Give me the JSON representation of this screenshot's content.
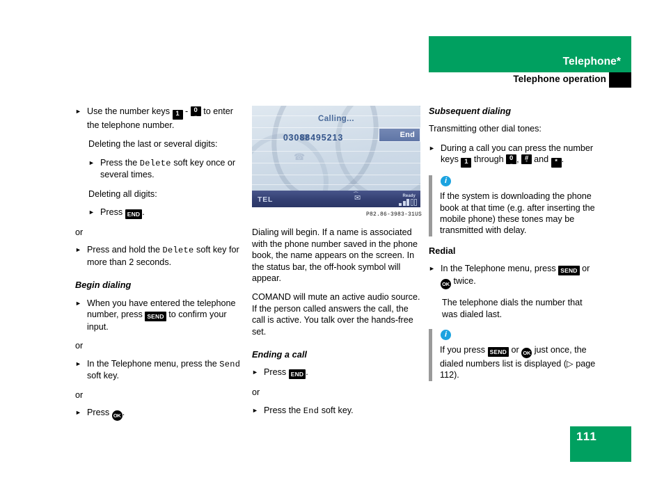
{
  "header": {
    "title": "Telephone*",
    "subtitle": "Telephone operation"
  },
  "footer": {
    "page_number": "111"
  },
  "colors": {
    "brand_green": "#00a060",
    "info_blue": "#1ba3e0",
    "note_bar_grey": "#9a9a9a",
    "screen_status_bar": "#333f72"
  },
  "left_column": {
    "b1_pre": "Use the number keys",
    "b1_key1": "1",
    "b1_dash": "-",
    "b1_key0": "0",
    "b1_post": "to enter the telephone number.",
    "p_delete_last": "Deleting the last or several digits:",
    "b2_pre": "Press the",
    "b2_softkey": "Delete",
    "b2_post": "soft key once or several times.",
    "p_delete_all": "Deleting all digits:",
    "b3_pre": "Press",
    "b3_key": "END",
    "b3_post": ".",
    "or1": "or",
    "b4_pre": "Press and hold the",
    "b4_softkey": "Delete",
    "b4_post": "soft key for more than 2 seconds.",
    "heading_begin_dialing": "Begin dialing",
    "b5_pre": "When you have entered the telephone number, press",
    "b5_key": "SEND",
    "b5_post": "to confirm your input.",
    "or2": "or",
    "b6_pre": "In the Telephone menu, press the",
    "b6_softkey": "Send",
    "b6_post": "soft key.",
    "or3": "or",
    "b7_pre": "Press",
    "b7_key": "OK",
    "b7_post": "."
  },
  "center_column": {
    "screen": {
      "calling_text": "Calling...",
      "phone_number": "03088495213",
      "softkey_end": "End",
      "status_source": "TEL",
      "status_ready": "Ready",
      "signal_bars_filled": 3,
      "signal_bars_empty": 2
    },
    "image_caption": "P82.86-3983-31US",
    "p1": "Dialing will begin. If a name is associated with the phone number saved in the phone book, the name appears on the screen. In the status bar, the off-hook symbol will appear.",
    "p2": "COMAND will mute an active audio source. If the person called answers the call, the call is active. You talk over the hands-free set.",
    "heading_ending_a_call": "Ending a call",
    "b1_pre": "Press",
    "b1_key": "END",
    "b1_post": ".",
    "or1": "or",
    "b2_pre": "Press the",
    "b2_softkey": "End",
    "b2_post": "soft key."
  },
  "right_column": {
    "heading_subsequent": "Subsequent dialing",
    "p_transmitting": "Transmitting other dial tones:",
    "b1_pre": "During a call you can press the number keys",
    "b1_key1": "1",
    "b1_mid": "through",
    "b1_key0": "0",
    "b1_comma": ",",
    "b1_keyhash": "#",
    "b1_and": "and",
    "b1_keystar": "*",
    "b1_end": ".",
    "note1_text": "If the system is downloading the phone book at that time (e.g. after inserting the mobile phone) these tones may be transmitted with delay.",
    "heading_redial": "Redial",
    "b2_pre": "In the Telephone menu, press",
    "b2_key_send": "SEND",
    "b2_or": "or",
    "b2_key_ok": "OK",
    "b2_post": "twice.",
    "p_dials_last": "The telephone dials the number that was dialed last.",
    "note2_pre": "If you press",
    "note2_key_send": "SEND",
    "note2_or": "or",
    "note2_key_ok": "OK",
    "note2_post": "just once, the dialed numbers list is displayed",
    "note2_ref": "(▷ page 112)."
  }
}
